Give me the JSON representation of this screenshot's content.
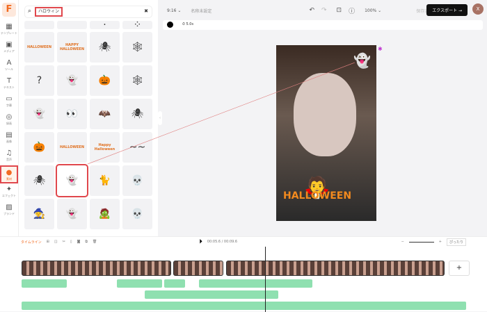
{
  "logo": "F",
  "rail": [
    {
      "label": "テンプレート",
      "icon": "template-icon",
      "g": "▦"
    },
    {
      "label": "メディア",
      "icon": "media-icon",
      "g": "▣"
    },
    {
      "label": "ツール",
      "icon": "ai-tool-icon",
      "g": "A"
    },
    {
      "label": "テキスト",
      "icon": "text-icon",
      "g": "T"
    },
    {
      "label": "字幕",
      "icon": "subtitle-icon",
      "g": "▭"
    },
    {
      "label": "録画",
      "icon": "record-icon",
      "g": "◎"
    },
    {
      "label": "画像",
      "icon": "image-icon",
      "g": "▤"
    },
    {
      "label": "音声",
      "icon": "music-icon",
      "g": "♫"
    },
    {
      "label": "素材",
      "icon": "elements-icon",
      "g": "●"
    },
    {
      "label": "エフェクト",
      "icon": "effects-icon",
      "g": "✦"
    },
    {
      "label": "ブランド",
      "icon": "brand-icon",
      "g": "▨"
    }
  ],
  "search": {
    "query": "ハロウィン"
  },
  "stickers": [
    "",
    "",
    "·",
    "⁘",
    "HALLOWEEN",
    "HAPPY HALLOWEEN",
    "🕷",
    "🕸",
    "?",
    "👻",
    "🎃",
    "🕸",
    "👻",
    "👀",
    "🦇",
    "🕷",
    "🎃",
    "HALLOWEEN",
    "Happy Halloween",
    "~~",
    "🕷",
    "👻",
    "🐈",
    "💀",
    "🧙",
    "👻",
    "🧟",
    "💀"
  ],
  "topbar": {
    "ratio": "9:16 ⌄",
    "name": "名称未設定",
    "zoom": "100% ⌄",
    "saved": "保存済み",
    "export": "エクスポート →",
    "avatar": "X"
  },
  "sub": {
    "duration": "5.0s"
  },
  "canvas": {
    "text": "HALLOWEEN"
  },
  "timeline": {
    "label": "タイムライン",
    "time": "00:05.6 / 00:09.6",
    "fit": "ぴったり",
    "add": "+"
  }
}
